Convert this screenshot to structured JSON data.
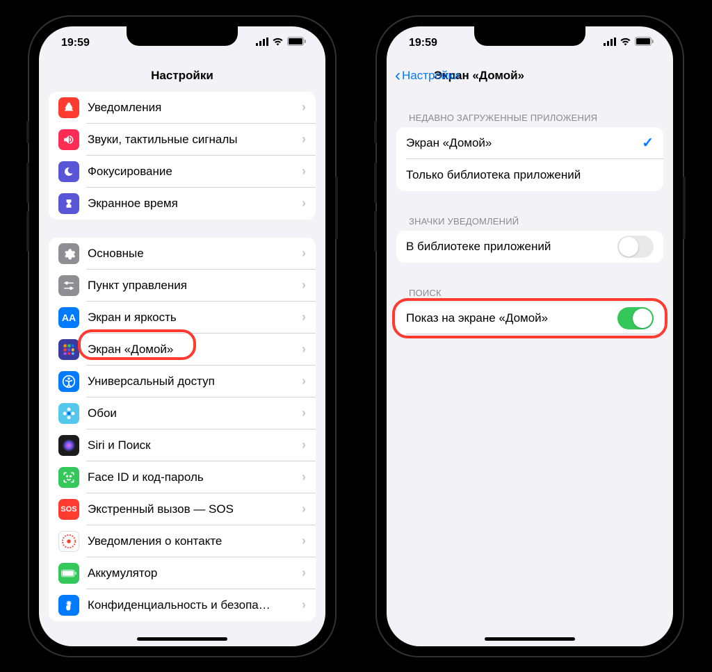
{
  "status": {
    "time": "19:59"
  },
  "phone1": {
    "title": "Настройки",
    "group1": [
      {
        "label": "Уведомления",
        "color": "#ff3b30",
        "icon": "bell"
      },
      {
        "label": "Звуки, тактильные сигналы",
        "color": "#ff2d55",
        "icon": "sound"
      },
      {
        "label": "Фокусирование",
        "color": "#5856d6",
        "icon": "moon"
      },
      {
        "label": "Экранное время",
        "color": "#5856d6",
        "icon": "hourglass"
      }
    ],
    "group2": [
      {
        "label": "Основные",
        "color": "#8e8e93",
        "icon": "gear"
      },
      {
        "label": "Пункт управления",
        "color": "#8e8e93",
        "icon": "sliders"
      },
      {
        "label": "Экран и яркость",
        "color": "#007aff",
        "icon": "aa"
      },
      {
        "label": "Экран «Домой»",
        "color": "#3a3a9f",
        "icon": "grid",
        "highlight": true
      },
      {
        "label": "Универсальный доступ",
        "color": "#007aff",
        "icon": "access"
      },
      {
        "label": "Обои",
        "color": "#54c7ec",
        "icon": "flower"
      },
      {
        "label": "Siri и Поиск",
        "color": "#1c1c1e",
        "icon": "siri"
      },
      {
        "label": "Face ID и код-пароль",
        "color": "#34c759",
        "icon": "face"
      },
      {
        "label": "Экстренный вызов — SOS",
        "color": "#ff3b30",
        "icon": "sos"
      },
      {
        "label": "Уведомления о контакте",
        "color": "#ffffff",
        "icon": "contact"
      },
      {
        "label": "Аккумулятор",
        "color": "#34c759",
        "icon": "battery"
      },
      {
        "label": "Конфиденциальность и безопа…",
        "color": "#007aff",
        "icon": "hand"
      }
    ]
  },
  "phone2": {
    "back": "Настройки",
    "title": "Экран «Домой»",
    "section1_header": "Недавно загруженные приложения",
    "section1": [
      {
        "label": "Экран «Домой»",
        "checked": true
      },
      {
        "label": "Только библиотека приложений",
        "checked": false
      }
    ],
    "section2_header": "Значки уведомлений",
    "section2": [
      {
        "label": "В библиотеке приложений",
        "toggle": false
      }
    ],
    "section3_header": "Поиск",
    "section3": [
      {
        "label": "Показ на экране «Домой»",
        "toggle": true,
        "highlight": true
      }
    ]
  }
}
